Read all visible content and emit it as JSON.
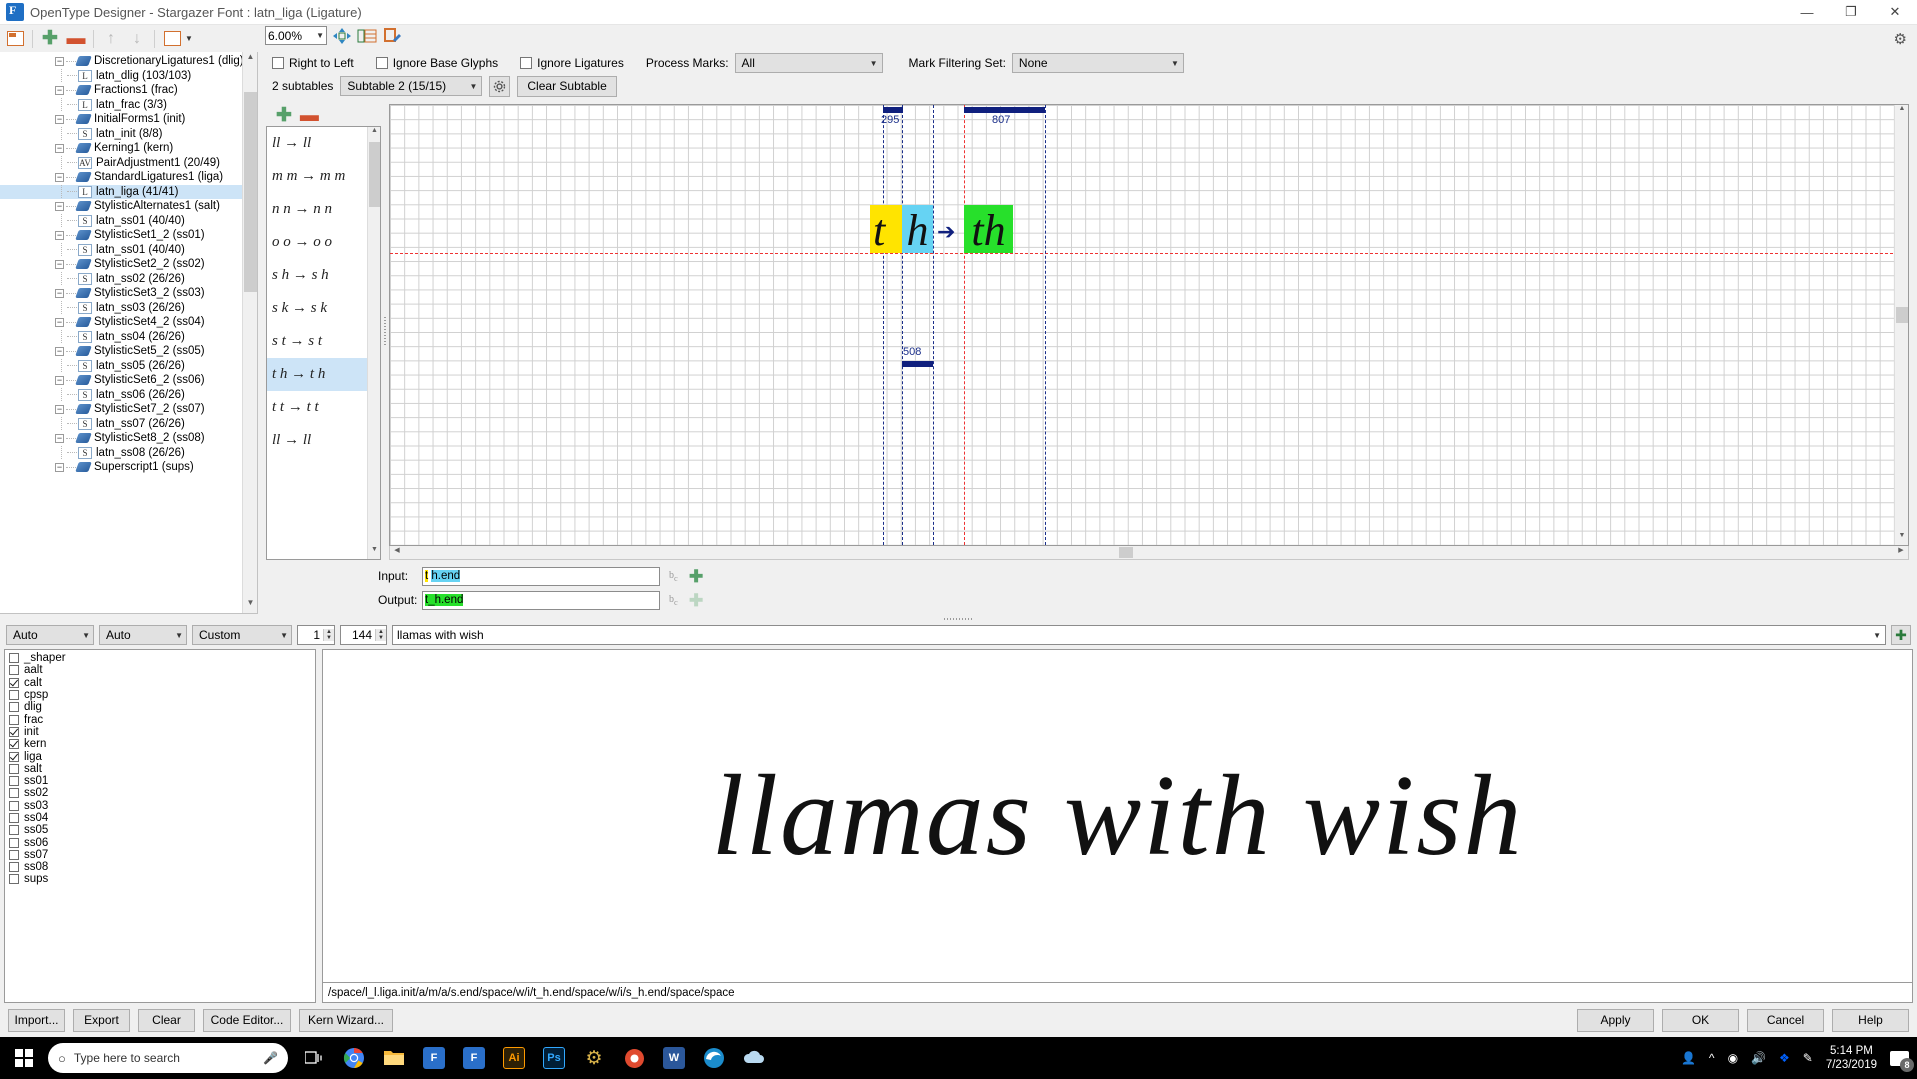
{
  "window": {
    "title": "OpenType Designer - Stargazer Font : latn_liga (Ligature)",
    "minimize": "—",
    "maximize": "❐",
    "close": "✕"
  },
  "toolbar": {
    "zoom_value": "6.00%",
    "icons": [
      "table-view-icon",
      "add-icon",
      "remove-icon",
      "move-up-icon",
      "move-down-icon",
      "subtable-icon",
      "settings-icon"
    ]
  },
  "tree": {
    "items": [
      {
        "label": "DiscretionaryLigatures1 (dlig)",
        "type": "lookup",
        "depth": 0,
        "selected": false
      },
      {
        "label": "latn_dlig (103/103)",
        "type": "L",
        "depth": 1,
        "selected": false
      },
      {
        "label": "Fractions1 (frac)",
        "type": "lookup",
        "depth": 0,
        "selected": false
      },
      {
        "label": "latn_frac (3/3)",
        "type": "L",
        "depth": 1,
        "selected": false
      },
      {
        "label": "InitialForms1 (init)",
        "type": "lookup",
        "depth": 0,
        "selected": false
      },
      {
        "label": "latn_init (8/8)",
        "type": "S",
        "depth": 1,
        "selected": false
      },
      {
        "label": "Kerning1 (kern)",
        "type": "lookup",
        "depth": 0,
        "selected": false
      },
      {
        "label": "PairAdjustment1 (20/49)",
        "type": "AV",
        "depth": 1,
        "selected": false
      },
      {
        "label": "StandardLigatures1 (liga)",
        "type": "lookup",
        "depth": 0,
        "selected": false
      },
      {
        "label": "latn_liga (41/41)",
        "type": "L",
        "depth": 1,
        "selected": true
      },
      {
        "label": "StylisticAlternates1 (salt)",
        "type": "lookup",
        "depth": 0,
        "selected": false
      },
      {
        "label": "latn_ss01 (40/40)",
        "type": "S",
        "depth": 1,
        "selected": false
      },
      {
        "label": "StylisticSet1_2 (ss01)",
        "type": "lookup",
        "depth": 0,
        "selected": false
      },
      {
        "label": "latn_ss01 (40/40)",
        "type": "S",
        "depth": 1,
        "selected": false
      },
      {
        "label": "StylisticSet2_2 (ss02)",
        "type": "lookup",
        "depth": 0,
        "selected": false
      },
      {
        "label": "latn_ss02 (26/26)",
        "type": "S",
        "depth": 1,
        "selected": false
      },
      {
        "label": "StylisticSet3_2 (ss03)",
        "type": "lookup",
        "depth": 0,
        "selected": false
      },
      {
        "label": "latn_ss03 (26/26)",
        "type": "S",
        "depth": 1,
        "selected": false
      },
      {
        "label": "StylisticSet4_2 (ss04)",
        "type": "lookup",
        "depth": 0,
        "selected": false
      },
      {
        "label": "latn_ss04 (26/26)",
        "type": "S",
        "depth": 1,
        "selected": false
      },
      {
        "label": "StylisticSet5_2 (ss05)",
        "type": "lookup",
        "depth": 0,
        "selected": false
      },
      {
        "label": "latn_ss05 (26/26)",
        "type": "S",
        "depth": 1,
        "selected": false
      },
      {
        "label": "StylisticSet6_2 (ss06)",
        "type": "lookup",
        "depth": 0,
        "selected": false
      },
      {
        "label": "latn_ss06 (26/26)",
        "type": "S",
        "depth": 1,
        "selected": false
      },
      {
        "label": "StylisticSet7_2 (ss07)",
        "type": "lookup",
        "depth": 0,
        "selected": false
      },
      {
        "label": "latn_ss07 (26/26)",
        "type": "S",
        "depth": 1,
        "selected": false
      },
      {
        "label": "StylisticSet8_2 (ss08)",
        "type": "lookup",
        "depth": 0,
        "selected": false
      },
      {
        "label": "latn_ss08 (26/26)",
        "type": "S",
        "depth": 1,
        "selected": false
      },
      {
        "label": "Superscript1 (sups)",
        "type": "lookup",
        "depth": 0,
        "selected": false
      }
    ]
  },
  "options": {
    "right_to_left": {
      "label": "Right to Left",
      "checked": false
    },
    "ignore_base_glyphs": {
      "label": "Ignore Base Glyphs",
      "checked": false
    },
    "ignore_ligatures": {
      "label": "Ignore Ligatures",
      "checked": false
    },
    "process_marks_label": "Process Marks:",
    "process_marks_value": "All",
    "mark_filtering_label": "Mark Filtering Set:",
    "mark_filtering_value": "None",
    "subtable_count": "2 subtables",
    "subtable_value": "Subtable 2 (15/15)",
    "clear_subtable": "Clear Subtable"
  },
  "glyph_list": {
    "items": [
      {
        "text": "ll → ll",
        "selected": false
      },
      {
        "text": "m m → m m",
        "selected": false
      },
      {
        "text": "n n → n n",
        "selected": false
      },
      {
        "text": "o o → o o",
        "selected": false
      },
      {
        "text": "s h → s h",
        "selected": false
      },
      {
        "text": "s k → s k",
        "selected": false
      },
      {
        "text": "s t → s t",
        "selected": false
      },
      {
        "text": "t h → t h",
        "selected": true
      },
      {
        "text": "t t → t t",
        "selected": false
      },
      {
        "text": "ll → ll",
        "selected": false
      }
    ]
  },
  "canvas": {
    "measure_left": "295",
    "measure_right": "807",
    "measure_bottom": "508",
    "input_glyph_1": "t",
    "input_glyph_2": "h",
    "output_glyph": "th",
    "colors": {
      "glyph1_bg": "#ffe400",
      "glyph2_bg": "#66d3f3",
      "output_bg": "#27e02b",
      "measure": "#10207e",
      "baseline": "#e33333"
    }
  },
  "io": {
    "input_label": "Input:",
    "input_part1": "t",
    "input_part2": "h.end",
    "output_label": "Output:",
    "output_value": "t_h.end"
  },
  "preview_controls": {
    "script": "Auto",
    "language": "Auto",
    "mode": "Custom",
    "count": "1",
    "size": "144",
    "sample_text": "llamas with wish"
  },
  "features": [
    {
      "name": "_shaper",
      "checked": false
    },
    {
      "name": "aalt",
      "checked": false
    },
    {
      "name": "calt",
      "checked": true
    },
    {
      "name": "cpsp",
      "checked": false
    },
    {
      "name": "dlig",
      "checked": false
    },
    {
      "name": "frac",
      "checked": false
    },
    {
      "name": "init",
      "checked": true
    },
    {
      "name": "kern",
      "checked": true
    },
    {
      "name": "liga",
      "checked": true
    },
    {
      "name": "salt",
      "checked": false
    },
    {
      "name": "ss01",
      "checked": false
    },
    {
      "name": "ss02",
      "checked": false
    },
    {
      "name": "ss03",
      "checked": false
    },
    {
      "name": "ss04",
      "checked": false
    },
    {
      "name": "ss05",
      "checked": false
    },
    {
      "name": "ss06",
      "checked": false
    },
    {
      "name": "ss07",
      "checked": false
    },
    {
      "name": "ss08",
      "checked": false
    },
    {
      "name": "sups",
      "checked": false
    }
  ],
  "preview": {
    "text": "llamas with wish",
    "status": "/space/l_l.liga.init/a/m/a/s.end/space/w/i/t_h.end/space/w/i/s_h.end/space/space"
  },
  "bottom_buttons": {
    "import": "Import...",
    "export": "Export",
    "clear": "Clear",
    "code_editor": "Code Editor...",
    "kern_wizard": "Kern Wizard...",
    "apply": "Apply",
    "ok": "OK",
    "cancel": "Cancel",
    "help": "Help"
  },
  "taskbar": {
    "search_placeholder": "Type here to search",
    "time": "5:14 PM",
    "date": "7/23/2019",
    "notification_count": "8",
    "apps": [
      "chrome",
      "file-explorer",
      "fontlab",
      "fontlab2",
      "illustrator",
      "photoshop",
      "settings",
      "recorder",
      "word",
      "edge",
      "onedrive"
    ]
  }
}
